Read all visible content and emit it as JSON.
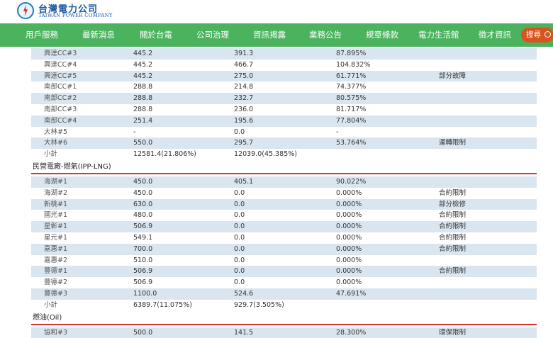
{
  "header": {
    "brand_zh": "台灣電力公司",
    "brand_en": "TAIWAN POWER COMPANY"
  },
  "nav": [
    "用戶服務",
    "最新消息",
    "關於台電",
    "公司治理",
    "資訊揭露",
    "業務公告",
    "規章條款",
    "電力生活館",
    "徵才資訊"
  ],
  "search": {
    "label": "搜尋"
  },
  "groups": [
    {
      "title": "",
      "rows": [
        {
          "name": "興達CC#3",
          "cap": "445.2",
          "gen": "391.3",
          "ratio": "87.895%",
          "note": ""
        },
        {
          "name": "興達CC#4",
          "cap": "445.2",
          "gen": "466.7",
          "ratio": "104.832%",
          "note": ""
        },
        {
          "name": "興達CC#5",
          "cap": "445.2",
          "gen": "275.0",
          "ratio": "61.771%",
          "note": "部分故障"
        },
        {
          "name": "南部CC#1",
          "cap": "288.8",
          "gen": "214.8",
          "ratio": "74.377%",
          "note": ""
        },
        {
          "name": "南部CC#2",
          "cap": "288.8",
          "gen": "232.7",
          "ratio": "80.575%",
          "note": ""
        },
        {
          "name": "南部CC#3",
          "cap": "288.8",
          "gen": "236.0",
          "ratio": "81.717%",
          "note": ""
        },
        {
          "name": "南部CC#4",
          "cap": "251.4",
          "gen": "195.6",
          "ratio": "77.804%",
          "note": ""
        },
        {
          "name": "大林#5",
          "cap": "-",
          "gen": "0.0",
          "ratio": "-",
          "note": ""
        },
        {
          "name": "大林#6",
          "cap": "550.0",
          "gen": "295.7",
          "ratio": "53.764%",
          "note": "運轉限制"
        },
        {
          "name": "小計",
          "cap": "12581.4(21.806%)",
          "gen": "12039.0(45.385%)",
          "ratio": "",
          "note": ""
        }
      ]
    },
    {
      "title": "民營電廠-燃氣(IPP-LNG)",
      "rows": [
        {
          "name": "海湖#1",
          "cap": "450.0",
          "gen": "405.1",
          "ratio": "90.022%",
          "note": ""
        },
        {
          "name": "海湖#2",
          "cap": "450.0",
          "gen": "0.0",
          "ratio": "0.000%",
          "note": "合約限制"
        },
        {
          "name": "新桃#1",
          "cap": "630.0",
          "gen": "0.0",
          "ratio": "0.000%",
          "note": "部分檢修"
        },
        {
          "name": "國光#1",
          "cap": "480.0",
          "gen": "0.0",
          "ratio": "0.000%",
          "note": "合約限制"
        },
        {
          "name": "星彰#1",
          "cap": "506.9",
          "gen": "0.0",
          "ratio": "0.000%",
          "note": "合約限制"
        },
        {
          "name": "星元#1",
          "cap": "549.1",
          "gen": "0.0",
          "ratio": "0.000%",
          "note": "合約限制"
        },
        {
          "name": "嘉惠#1",
          "cap": "700.0",
          "gen": "0.0",
          "ratio": "0.000%",
          "note": "合約限制"
        },
        {
          "name": "嘉惠#2",
          "cap": "510.0",
          "gen": "0.0",
          "ratio": "0.000%",
          "note": ""
        },
        {
          "name": "豐德#1",
          "cap": "506.9",
          "gen": "0.0",
          "ratio": "0.000%",
          "note": "合約限制"
        },
        {
          "name": "豐德#2",
          "cap": "506.9",
          "gen": "0.0",
          "ratio": "0.000%",
          "note": ""
        },
        {
          "name": "豐德#3",
          "cap": "1100.0",
          "gen": "524.6",
          "ratio": "47.691%",
          "note": ""
        },
        {
          "name": "小計",
          "cap": "6389.7(11.075%)",
          "gen": "929.7(3.505%)",
          "ratio": "",
          "note": ""
        }
      ]
    },
    {
      "title": "燃油(Oil)",
      "rows": [
        {
          "name": "協和#3",
          "cap": "500.0",
          "gen": "141.5",
          "ratio": "28.300%",
          "note": "環保限制"
        }
      ]
    }
  ]
}
